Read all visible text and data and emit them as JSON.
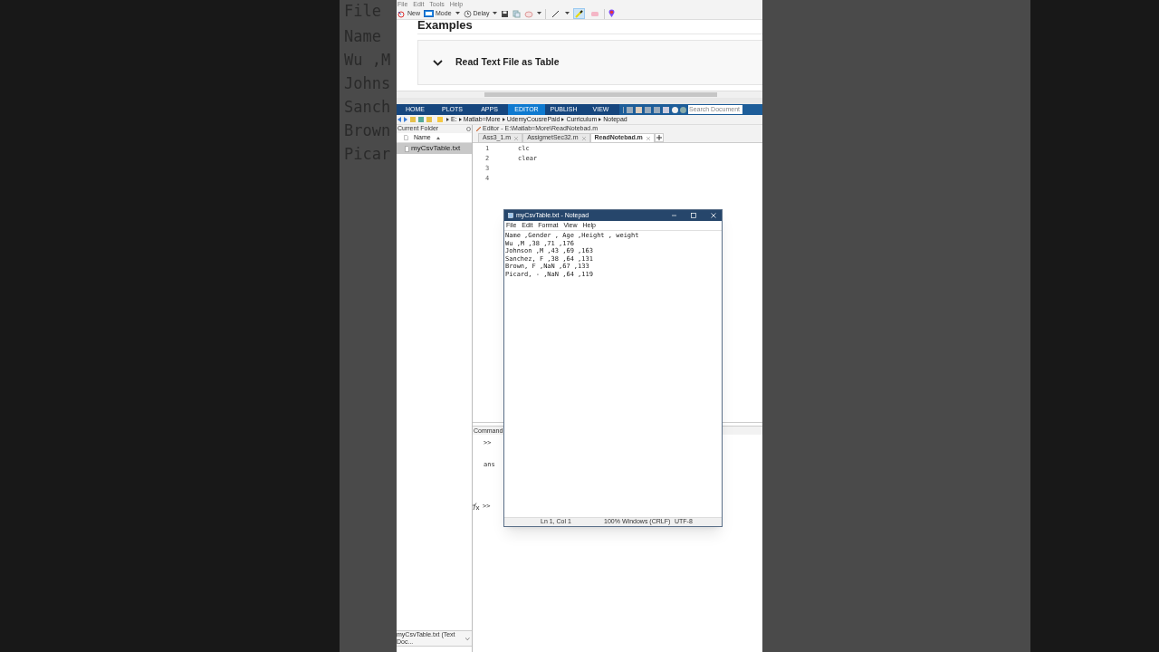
{
  "backdrop": {
    "lines": [
      "File",
      "Name",
      "Wu ,M",
      "Johns",
      "Sanch",
      "Brown",
      "Picar"
    ]
  },
  "snip_tool": {
    "menu": [
      "File",
      "Edit",
      "Tools",
      "Help"
    ],
    "buttons": [
      {
        "kind": "new",
        "label": "New"
      },
      {
        "kind": "mode",
        "label": "Mode"
      },
      {
        "kind": "delay",
        "label": "Delay"
      }
    ],
    "tools": [
      {
        "kind": "pen",
        "selected": false
      },
      {
        "kind": "highlighter",
        "selected": true
      },
      {
        "kind": "eraser",
        "selected": false
      }
    ]
  },
  "doc": {
    "heading": "Examples",
    "section": {
      "title": "Read Text File as Table",
      "expanded": true
    }
  },
  "matlab": {
    "tabs": [
      {
        "label": "HOME",
        "selected": false
      },
      {
        "label": "PLOTS",
        "selected": false
      },
      {
        "label": "APPS",
        "selected": false
      },
      {
        "label": "EDITOR",
        "selected": true
      },
      {
        "label": "PUBLISH",
        "selected": false
      },
      {
        "label": "VIEW",
        "selected": false
      }
    ],
    "search_placeholder": "Search Document",
    "path": [
      "E:",
      "Matlab=More",
      "UdemyCousrePaid",
      "Curriculum",
      "Notepad"
    ],
    "current_folder": {
      "title": "Current Folder",
      "column": "Name",
      "files": [
        {
          "name": "myCsvTable.txt",
          "selected": true
        }
      ],
      "details": "myCsvTable.txt  (Text Doc..."
    },
    "editor": {
      "title": "Editor - E:\\Matlab=More\\ReadNotebad.m",
      "tabs": [
        {
          "label": "Ass3_1.m",
          "selected": false
        },
        {
          "label": "AssigmetSec32.m",
          "selected": false
        },
        {
          "label": "ReadNotebad.m",
          "selected": true
        }
      ],
      "lines": [
        {
          "number": "1",
          "code": "clc"
        },
        {
          "number": "2",
          "code": "clear"
        },
        {
          "number": "3"
        },
        {
          "number": "4"
        }
      ]
    },
    "command_window": {
      "title": "Command",
      "output": [
        ">>",
        "ans"
      ],
      "prompt": ">>"
    }
  },
  "notepad": {
    "title": "myCsvTable.txt - Notepad",
    "menu": [
      "File",
      "Edit",
      "Format",
      "View",
      "Help"
    ],
    "lines": [
      "Name ,Gender , Age ,Height , weight",
      "Wu ,M ,38 ,71 ,176",
      "Johnson ,M ,43 ,69 ,163",
      "Sanchez, F ,38 ,64 ,131",
      "Brown, F ,NaN ,67 ,133",
      "Picard, - ,NaN ,64 ,119"
    ],
    "status": [
      "Ln 1, Col 1",
      "100%",
      "Windows (CRLF)",
      "UTF-8"
    ]
  }
}
